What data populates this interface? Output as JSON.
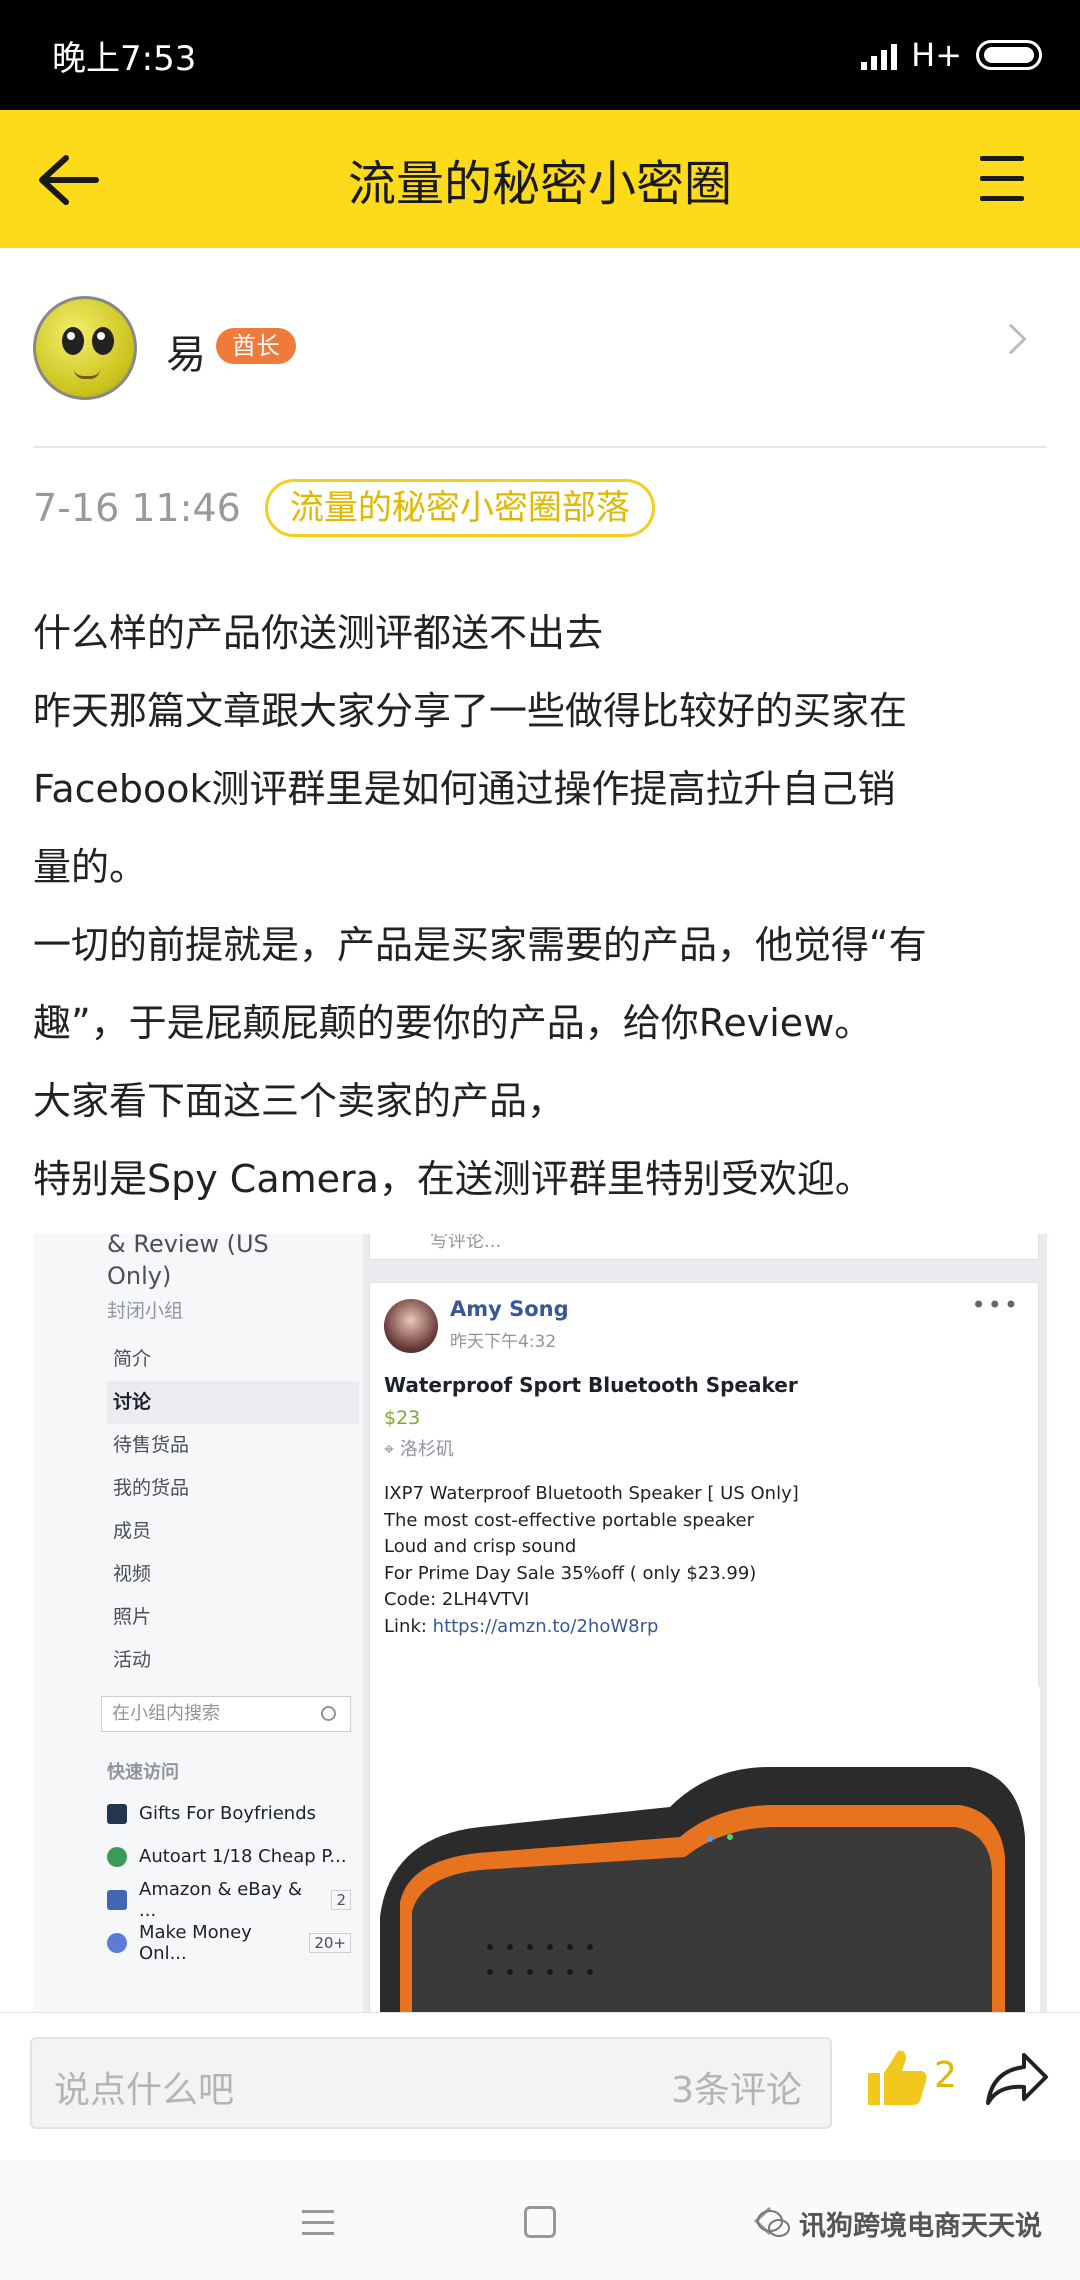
{
  "status_bar": {
    "time": "晚上7:53",
    "network": "H+"
  },
  "header": {
    "title": "流量的秘密小密圈"
  },
  "post": {
    "author": {
      "name": "易",
      "badge": "酋长"
    },
    "date": "7-16 11:46",
    "tribe": "流量的秘密小密圈部落",
    "lines": [
      "什么样的产品你送测评都送不出去",
      "昨天那篇文章跟大家分享了一些做得比较好的买家在",
      "Facebook测评群里是如何通过操作提高拉升自己销",
      "量的。",
      "一切的前提就是，产品是买家需要的产品，他觉得“有",
      "趣”，于是屁颠屁颠的要你的产品，给你Review。",
      "大家看下面这三个卖家的产品，",
      "特别是Spy Camera，在送测评群里特别受欢迎。"
    ]
  },
  "embedded_screenshot": {
    "group_name_line1": "& Review (US",
    "group_name_line2": "Only)",
    "group_type": "封闭小组",
    "composer_placeholder": "写评论...",
    "nav": [
      "简介",
      "讨论",
      "待售货品",
      "我的货品",
      "成员",
      "视频",
      "照片",
      "活动"
    ],
    "active_nav": "讨论",
    "search_placeholder": "在小组内搜索",
    "quick_access_title": "快速访问",
    "quick_access": [
      {
        "label": "Gifts For Boyfriends",
        "count": "",
        "color": "#23364e"
      },
      {
        "label": "Autoart 1/18 Cheap P...",
        "count": "",
        "color": "#3a9a5a"
      },
      {
        "label": "Amazon & eBay & ...",
        "count": "2",
        "color": "#4267b2"
      },
      {
        "label": "Make Money Onl...",
        "count": "20+",
        "color": "#5b7bd5"
      }
    ],
    "fb_post": {
      "author": "Amy Song",
      "time": "昨天下午4:32",
      "title": "Waterproof Sport Bluetooth Speaker",
      "price": "$23",
      "location": "洛杉矶",
      "lines": [
        "IXP7 Waterproof Bluetooth Speaker [ US Only]",
        "The most cost-effective portable speaker",
        "Loud and crisp sound",
        "For Prime Day Sale 35%off ( only $23.99)",
        "Code: 2LH4VTVI"
      ],
      "link_label": "Link: ",
      "link": "https://amzn.to/2hoW8rp"
    }
  },
  "bottom_bar": {
    "comment_placeholder": "说点什么吧",
    "comment_count": "3条评论",
    "likes": "2"
  },
  "watermark": "讯狗跨境电商天天说",
  "colors": {
    "accent": "#fddb1a",
    "badge": "#f07a3c",
    "like": "#e0b800"
  }
}
